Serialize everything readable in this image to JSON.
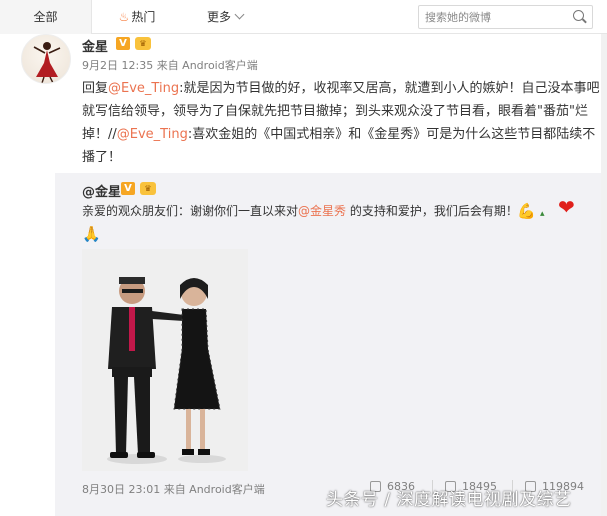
{
  "tabs": [
    {
      "label": "全部",
      "active": true
    },
    {
      "label": "热门",
      "icon": "fire-icon"
    },
    {
      "label": "更多",
      "icon": "chevron-down-icon"
    }
  ],
  "search": {
    "placeholder": "搜索她的微博"
  },
  "post": {
    "author": "金星",
    "meta": "9月2日 12:35 来自 Android客户端",
    "reply_prefix": "回复",
    "mention1": "@Eve_Ting",
    "text1": ":就是因为节目做的好，收视率又居高，就遭到小人的嫉妒！自己没本事吧就写信给领导，领导为了自保就先把节目撤掉；到头来观众没了节目看，眼看着\"番茄\"烂掉！//",
    "mention2": "@Eve_Ting",
    "text2": ":喜欢金姐的《中国式相亲》和《金星秀》可是为什么这些节目都陆续不播了！"
  },
  "repost": {
    "author": "@金星",
    "text_a": "亲爱的观众朋友们：谢谢你们一直以来对",
    "mention": "@金星秀",
    "text_b": " 的支持和爱护，我们后会有期！",
    "meta": "8月30日 23:01 来自 Android客户端",
    "stats": {
      "forward": "6836",
      "comment": "18495",
      "like": "119894"
    }
  },
  "watermark": "头条号 / 深度解读电视剧及综艺",
  "colors": {
    "accent": "#eb7350",
    "badge": "#f6a623",
    "repost_bg": "#f2f2f5"
  }
}
